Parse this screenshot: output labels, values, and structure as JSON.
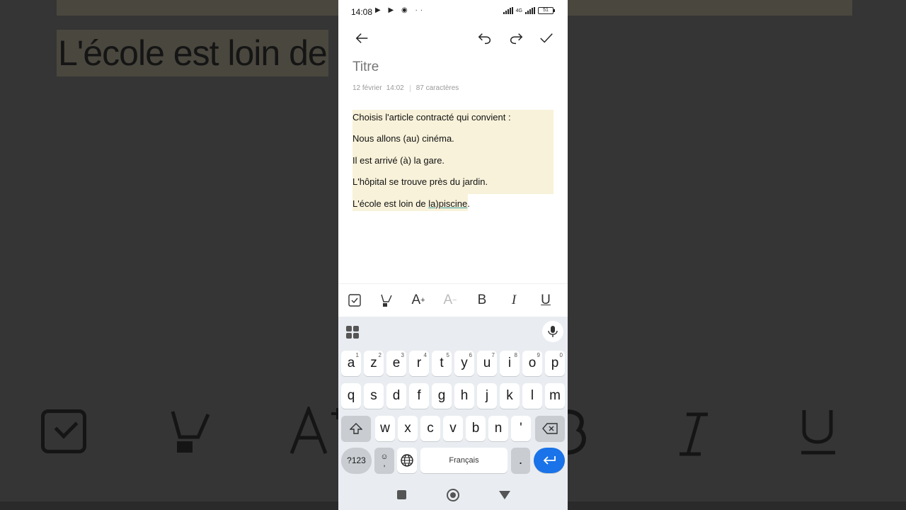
{
  "status": {
    "time": "14:08",
    "left_icons": "▶ ▶ ◉ ··",
    "network": "4G",
    "battery": "51"
  },
  "note": {
    "title_placeholder": "Titre",
    "date": "12 février",
    "time": "14:02",
    "chars": "87 caractères",
    "lines": [
      "Choisis l'article contracté qui convient :",
      "Nous allons (au) cinéma.",
      "Il est arrivé (à) la gare.",
      "L'hôpital se trouve près du jardin."
    ],
    "last_line_prefix": "L'école est loin de ",
    "last_line_underlined": "la)piscine",
    "last_line_suffix": "."
  },
  "background": {
    "text": "L'école est loin de"
  },
  "format_toolbar": {
    "bold": "B",
    "italic": "I",
    "underline": "U",
    "font_increase": "A",
    "font_decrease": "A"
  },
  "keyboard": {
    "row1": [
      {
        "k": "a",
        "s": "1"
      },
      {
        "k": "z",
        "s": "2"
      },
      {
        "k": "e",
        "s": "3"
      },
      {
        "k": "r",
        "s": "4"
      },
      {
        "k": "t",
        "s": "5"
      },
      {
        "k": "y",
        "s": "6"
      },
      {
        "k": "u",
        "s": "7"
      },
      {
        "k": "i",
        "s": "8"
      },
      {
        "k": "o",
        "s": "9"
      },
      {
        "k": "p",
        "s": "0"
      }
    ],
    "row2": [
      "q",
      "s",
      "d",
      "f",
      "g",
      "h",
      "j",
      "k",
      "l",
      "m"
    ],
    "row3": [
      "w",
      "x",
      "c",
      "v",
      "b",
      "n",
      "'"
    ],
    "symbols_label": "?123",
    "comma_label": ",",
    "space_label": "Français",
    "period_label": "."
  }
}
